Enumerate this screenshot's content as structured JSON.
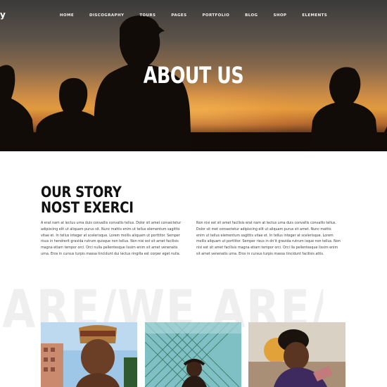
{
  "brand": {
    "glyph": "y"
  },
  "nav": {
    "items": [
      {
        "label": "HOME"
      },
      {
        "label": "DISCOGRAPHY"
      },
      {
        "label": "TOURS"
      },
      {
        "label": "PAGES"
      },
      {
        "label": "PORTFOLIO"
      },
      {
        "label": "BLOG"
      },
      {
        "label": "SHOP"
      },
      {
        "label": "ELEMENTS"
      }
    ]
  },
  "hero": {
    "title": "ABOUT US"
  },
  "story": {
    "title_line1": "OUR STORY",
    "title_line2": "NOST EXERCI",
    "col_left": "A erat nam at lectus urna duis convallis convallis tellus. Dolor sit amet consectetur adipiscing elit ut aliquam purus sit. Nunc mattis enim ut tellus elementum sagittis vitae et. In tellus integer at scelerisque. Lorem mollis aliquam ut porttitor. Semper risus in hendrerit gravida rutrum quisque non tellus. Non nisi est sit amet facilisis magna etiam tempor orci. Orci nulla pellentesque lissim enim sit amet venenatis urna. Eros in cursus turpis massa tincidunt dui lectus ringilla est corper eget nulla.",
    "col_right": "Non nisi est sit amet facilisis erat nam at lectus urna duis convallis convallis tellus. Dolor sit met consectetur adipiscing elit ut aliquam purus sit amet. Nunc mattis enim ut tellus elementum sagittis vitae et. In tellus integer at scelerisque. Lorem mollis aliquam ut porttitor. Semper risus in dn'it gravida rutrum isque non tellus. Non nisi est sit amet facilisis magna etiam tempor orci. Orci lla pellentesque lissim enim sit amet venenatis urna. Eros in cursus turpis massa tincidunt facilisis attis."
  },
  "watermark": {
    "text": "ARE/WE ARE/WE A"
  },
  "colors": {
    "accent_text": "#111111",
    "body_text": "#3c3c3c",
    "watermark": "#efefef",
    "nav_text": "#f2f2f2"
  }
}
